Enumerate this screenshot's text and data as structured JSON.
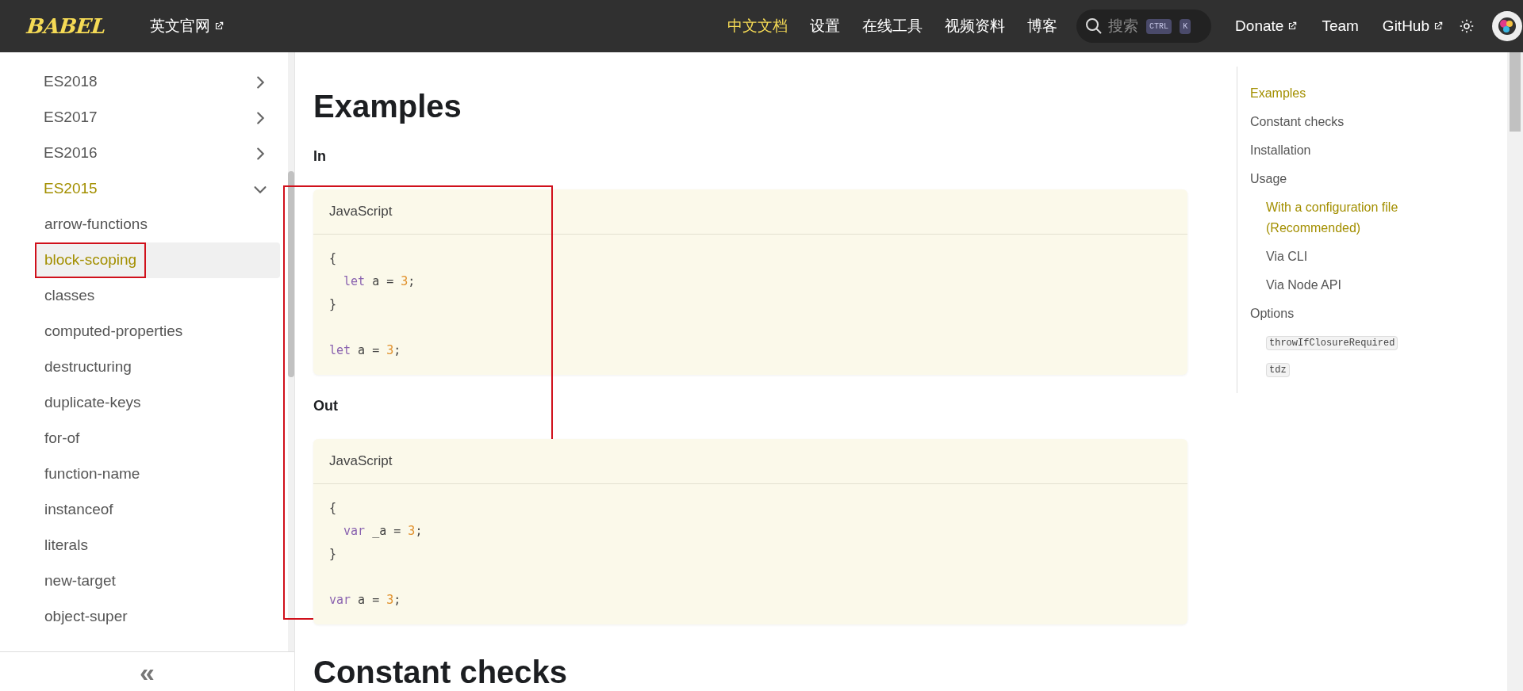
{
  "navbar": {
    "logo": "BABEL",
    "links": [
      {
        "label": "英文官网",
        "external": true
      }
    ],
    "nav": [
      {
        "label": "中文文档",
        "selected": true
      },
      {
        "label": "设置",
        "selected": false
      },
      {
        "label": "在线工具",
        "selected": false
      },
      {
        "label": "视频资料",
        "selected": false
      },
      {
        "label": "博客",
        "selected": false
      }
    ],
    "search": {
      "placeholder": "搜索",
      "keys": [
        "CTRL",
        "K"
      ]
    },
    "right_links": [
      {
        "label": "Donate",
        "external": true
      },
      {
        "label": "Team",
        "external": false
      },
      {
        "label": "GitHub",
        "external": true
      }
    ]
  },
  "sidebar": {
    "items": [
      {
        "label": "ES2018",
        "expanded": false,
        "selected": false
      },
      {
        "label": "ES2017",
        "expanded": false,
        "selected": false
      },
      {
        "label": "ES2016",
        "expanded": false,
        "selected": false
      },
      {
        "label": "ES2015",
        "expanded": true,
        "selected": true,
        "children": [
          {
            "label": "arrow-functions",
            "selected": false,
            "outlined": false
          },
          {
            "label": "block-scoping",
            "selected": true,
            "outlined": true
          },
          {
            "label": "classes",
            "selected": false,
            "outlined": false
          },
          {
            "label": "computed-properties",
            "selected": false,
            "outlined": false
          },
          {
            "label": "destructuring",
            "selected": false,
            "outlined": false
          },
          {
            "label": "duplicate-keys",
            "selected": false,
            "outlined": false
          },
          {
            "label": "for-of",
            "selected": false,
            "outlined": false
          },
          {
            "label": "function-name",
            "selected": false,
            "outlined": false
          },
          {
            "label": "instanceof",
            "selected": false,
            "outlined": false
          },
          {
            "label": "literals",
            "selected": false,
            "outlined": false
          },
          {
            "label": "new-target",
            "selected": false,
            "outlined": false
          },
          {
            "label": "object-super",
            "selected": false,
            "outlined": false
          }
        ]
      }
    ],
    "collapse_button": "«"
  },
  "content": {
    "blocks": [
      {
        "kind": "h1",
        "text": "Examples"
      },
      {
        "kind": "h4",
        "text": "In"
      },
      {
        "kind": "code",
        "language": "JavaScript",
        "framed": true,
        "groups": [
          [
            [
              {
                "kind": "plain",
                "text": "{"
              }
            ],
            [
              {
                "kind": "keyword",
                "text": "  let"
              },
              {
                "kind": "plain",
                "text": " a = "
              },
              {
                "kind": "number",
                "text": "3"
              },
              {
                "kind": "plain",
                "text": ";"
              }
            ],
            [
              {
                "kind": "plain",
                "text": "}"
              }
            ]
          ],
          [
            [
              {
                "kind": "keyword",
                "text": "let"
              },
              {
                "kind": "plain",
                "text": " a = "
              },
              {
                "kind": "number",
                "text": "3"
              },
              {
                "kind": "plain",
                "text": ";"
              }
            ]
          ]
        ]
      },
      {
        "kind": "h4",
        "text": "Out"
      },
      {
        "kind": "code",
        "language": "JavaScript",
        "framed": false,
        "groups": [
          [
            [
              {
                "kind": "plain",
                "text": "{"
              }
            ],
            [
              {
                "kind": "keyword",
                "text": "  var"
              },
              {
                "kind": "plain",
                "text": " _a = "
              },
              {
                "kind": "number",
                "text": "3"
              },
              {
                "kind": "plain",
                "text": ";"
              }
            ],
            [
              {
                "kind": "plain",
                "text": "}"
              }
            ]
          ],
          [
            [
              {
                "kind": "keyword",
                "text": "var"
              },
              {
                "kind": "plain",
                "text": " a = "
              },
              {
                "kind": "number",
                "text": "3"
              },
              {
                "kind": "plain",
                "text": ";"
              }
            ]
          ]
        ]
      },
      {
        "kind": "h1",
        "text": "Constant checks"
      }
    ]
  },
  "toc": {
    "items": [
      {
        "kind": "link",
        "label": "Examples",
        "selected": true
      },
      {
        "kind": "link",
        "label": "Constant checks",
        "selected": false
      },
      {
        "kind": "link",
        "label": "Installation",
        "selected": false
      },
      {
        "kind": "link",
        "label": "Usage",
        "selected": false,
        "children": [
          {
            "kind": "link",
            "label": "With a configuration file (Recommended)",
            "selected": true
          },
          {
            "kind": "link",
            "label": "Via CLI",
            "selected": false
          },
          {
            "kind": "link",
            "label": "Via Node API",
            "selected": false
          }
        ]
      },
      {
        "kind": "link",
        "label": "Options",
        "selected": false,
        "children": [
          {
            "kind": "code",
            "label": "throwIfClosureRequired",
            "selected": false
          },
          {
            "kind": "code",
            "label": "tdz",
            "selected": false
          }
        ]
      }
    ]
  }
}
